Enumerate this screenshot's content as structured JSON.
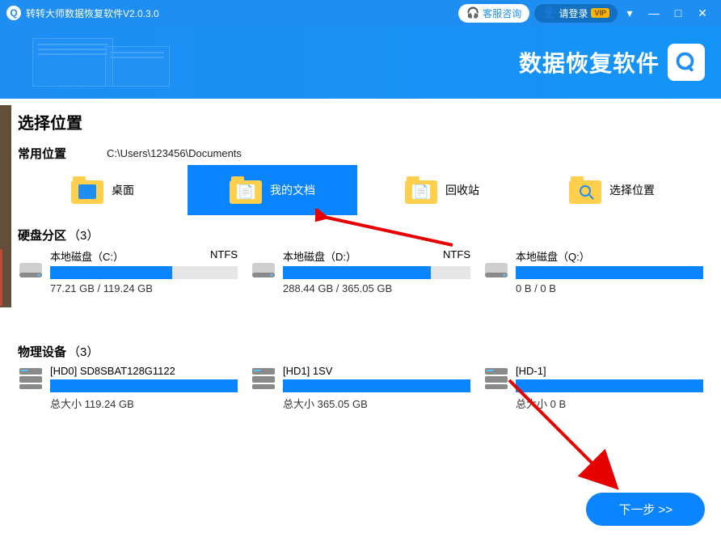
{
  "titlebar": {
    "app_title": "转转大师数据恢复软件V2.0.3.0",
    "consult": "客服咨询",
    "login": "请登录",
    "vip": "VIP"
  },
  "banner": {
    "title": "数据恢复软件"
  },
  "section_heading": "选择位置",
  "common_locations": {
    "label": "常用位置",
    "path": "C:\\Users\\123456\\Documents",
    "items": [
      {
        "name": "桌面"
      },
      {
        "name": "我的文档"
      },
      {
        "name": "回收站"
      },
      {
        "name": "选择位置"
      }
    ]
  },
  "partitions": {
    "label": "硬盘分区",
    "count": "（3）",
    "items": [
      {
        "title": "本地磁盘（C:）",
        "fs": "NTFS",
        "cap": "77.21 GB / 119.24 GB",
        "fill": 65
      },
      {
        "title": "本地磁盘（D:）",
        "fs": "NTFS",
        "cap": "288.44 GB / 365.05 GB",
        "fill": 79
      },
      {
        "title": "本地磁盘（Q:）",
        "fs": "",
        "cap": "0 B / 0 B",
        "fill": 100
      }
    ]
  },
  "devices": {
    "label": "物理设备",
    "count": "（3）",
    "items": [
      {
        "name": "[HD0] SD8SBAT128G1122",
        "cap": "总大小 119.24 GB"
      },
      {
        "name": "[HD1] 1SV",
        "cap": "总大小 365.05 GB"
      },
      {
        "name": "[HD-1]",
        "cap": "总大小 0 B"
      }
    ]
  },
  "next_button": "下一步 >>"
}
